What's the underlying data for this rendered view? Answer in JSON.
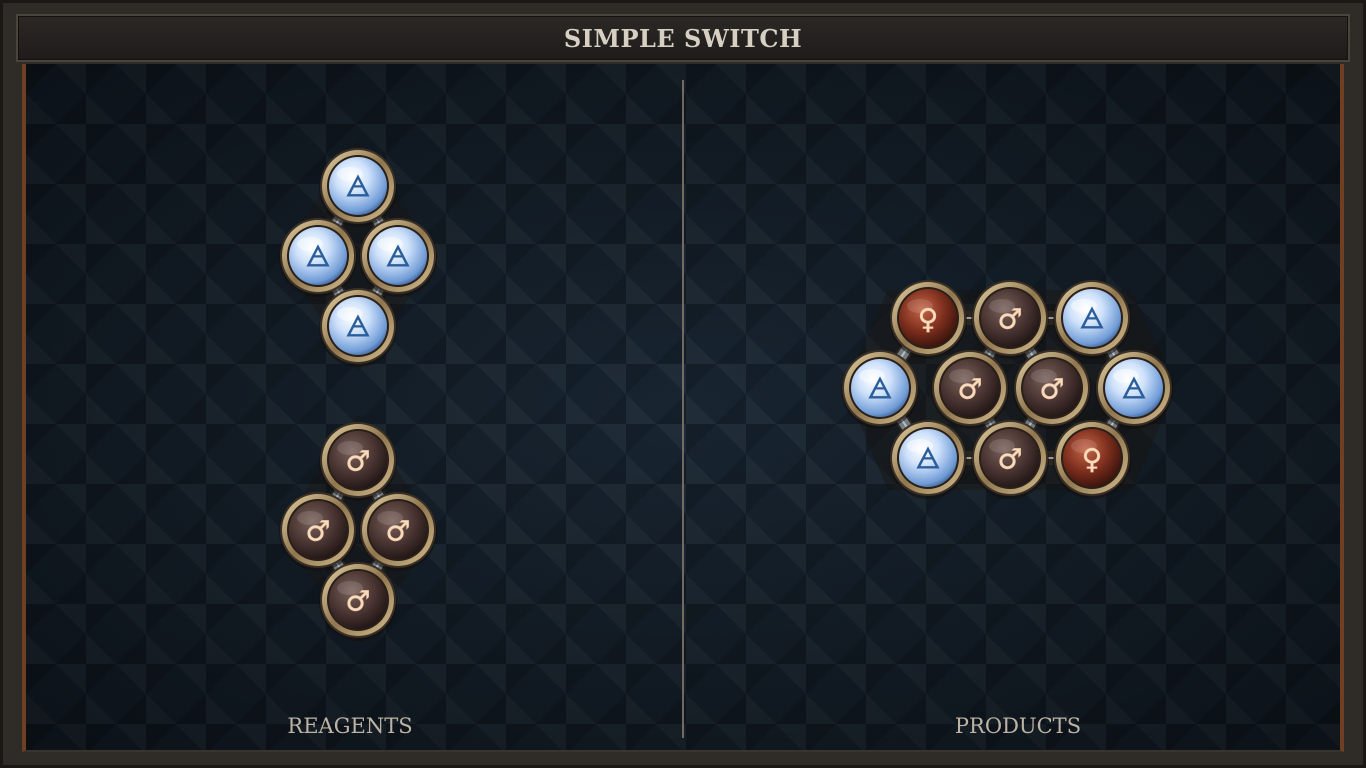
{
  "title": "SIMPLE SWITCH",
  "reagents_label": "REAGENTS",
  "products_label": "PRODUCTS",
  "colors": {
    "air": "#aacdf5",
    "iron": "#5b4440",
    "copper": "#8a3a26",
    "frame_rim": "#b99f73"
  },
  "symbols": {
    "air": "🜁",
    "iron": "♂",
    "copper": "♀"
  },
  "reagent_molecules": [
    {
      "name": "air-molecule",
      "atoms": [
        {
          "element": "air",
          "symbol": "🜁"
        },
        {
          "element": "air",
          "symbol": "🜁"
        },
        {
          "element": "air",
          "symbol": "🜁"
        },
        {
          "element": "air",
          "symbol": "🜁"
        }
      ]
    },
    {
      "name": "iron-molecule",
      "atoms": [
        {
          "element": "iron",
          "symbol": "♂"
        },
        {
          "element": "iron",
          "symbol": "♂"
        },
        {
          "element": "iron",
          "symbol": "♂"
        },
        {
          "element": "iron",
          "symbol": "♂"
        }
      ]
    }
  ],
  "product_molecule": {
    "name": "product-molecule",
    "atoms": [
      {
        "element": "copper",
        "symbol": "♀"
      },
      {
        "element": "iron",
        "symbol": "♂"
      },
      {
        "element": "air",
        "symbol": "🜁"
      },
      {
        "element": "air",
        "symbol": "🜁"
      },
      {
        "element": "iron",
        "symbol": "♂"
      },
      {
        "element": "iron",
        "symbol": "♂"
      },
      {
        "element": "air",
        "symbol": "🜁"
      },
      {
        "element": "air",
        "symbol": "🜁"
      },
      {
        "element": "iron",
        "symbol": "♂"
      },
      {
        "element": "copper",
        "symbol": "♀"
      }
    ]
  }
}
